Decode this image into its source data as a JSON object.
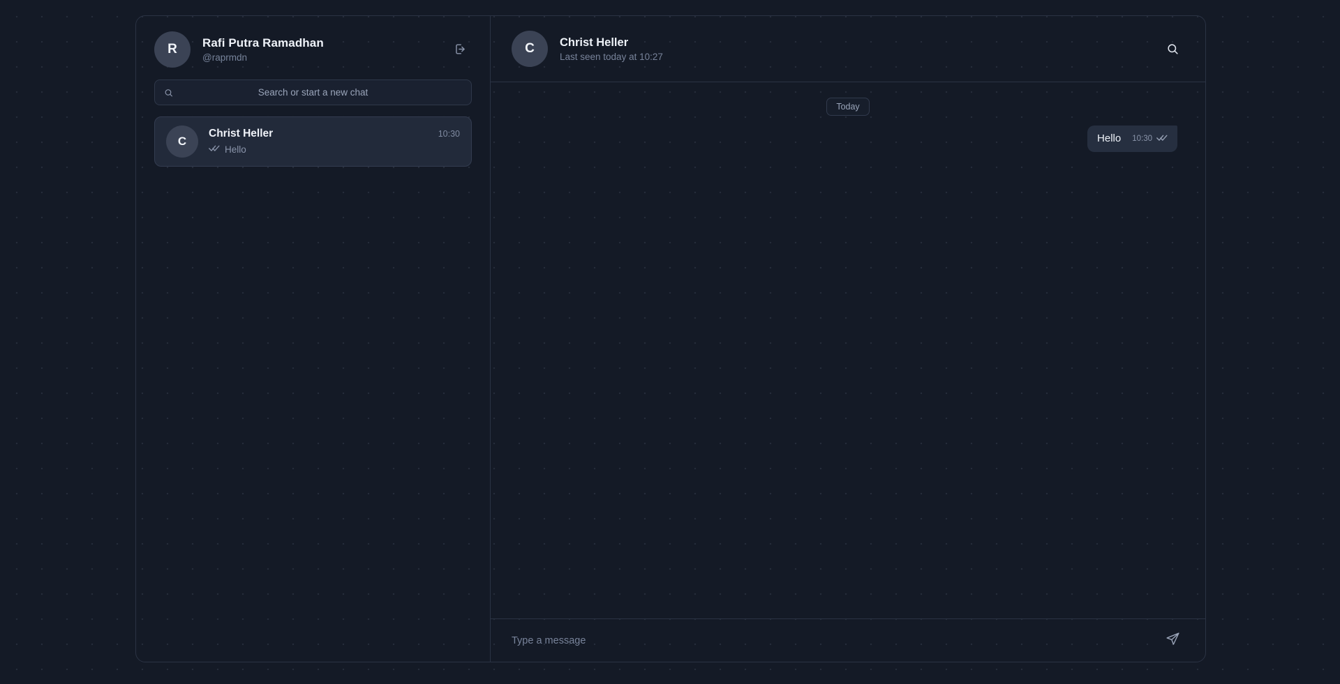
{
  "theme": {
    "background": "#141a26",
    "panel_border": "#2b3344",
    "bubble_out": "#262f40",
    "active_item": "#222a3a",
    "avatar": "#3b4355",
    "text_primary": "#eef2f8",
    "text_muted": "#78839a"
  },
  "sidebar": {
    "profile": {
      "avatar_initial": "R",
      "name": "Rafi Putra Ramadhan",
      "handle": "@raprmdn"
    },
    "logout_icon": "logout-icon",
    "search": {
      "placeholder": "Search or start a new chat",
      "value": "",
      "icon": "search-icon"
    },
    "chats": [
      {
        "avatar_initial": "C",
        "name": "Christ Heller",
        "time": "10:30",
        "preview": "Hello",
        "status_icon": "double-check-icon",
        "active": true
      }
    ]
  },
  "chat": {
    "header": {
      "avatar_initial": "C",
      "name": "Christ Heller",
      "status": "Last seen today at 10:27",
      "search_icon": "search-icon"
    },
    "day_divider": "Today",
    "messages": [
      {
        "direction": "out",
        "text": "Hello",
        "time": "10:30",
        "status_icon": "double-check-icon"
      }
    ],
    "composer": {
      "placeholder": "Type a message",
      "value": "",
      "send_icon": "send-icon"
    }
  }
}
